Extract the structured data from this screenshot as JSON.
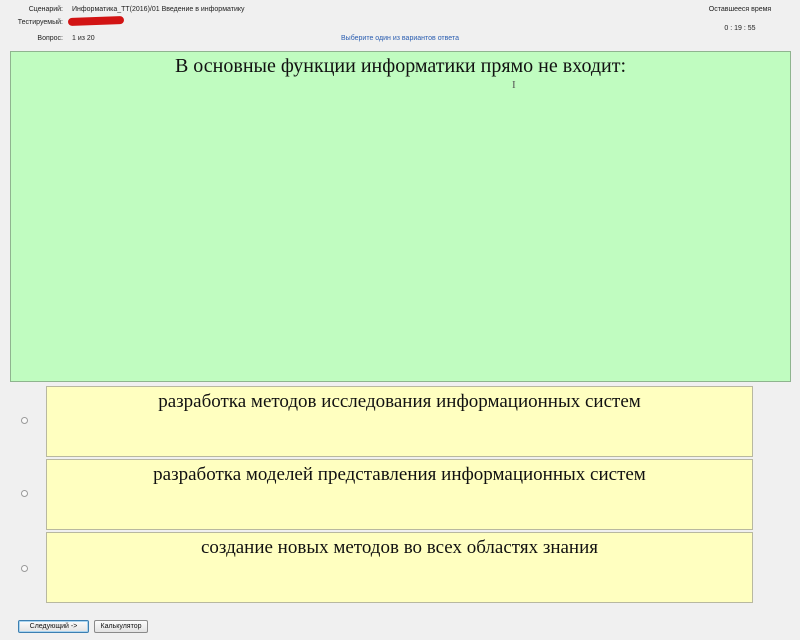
{
  "header": {
    "scenario_label": "Сценарий:",
    "scenario_value": "Информатика_ТТ(2016)/01 Введение в информатику",
    "tester_label": "Тестируемый:",
    "question_label": "Вопрос:",
    "question_value": "1 из 20",
    "hint": "Выберите один из вариантов ответа",
    "time_label": "Оставшееся время",
    "time_value": "0 : 19 : 55"
  },
  "question": {
    "text": "В основные функции информатики прямо не входит:",
    "background": "#c0fcc0"
  },
  "options": [
    {
      "text": "разработка методов исследования информационных систем",
      "selected": false
    },
    {
      "text": "разработка моделей представления информационных систем",
      "selected": false
    },
    {
      "text": "создание новых методов во всех областях знания",
      "selected": false
    }
  ],
  "option_background": "#ffffc0",
  "buttons": {
    "next_label": "Следующий ->",
    "calculator_label": "Калькулятор"
  },
  "icons": {
    "text_cursor": "text-cursor-icon"
  }
}
